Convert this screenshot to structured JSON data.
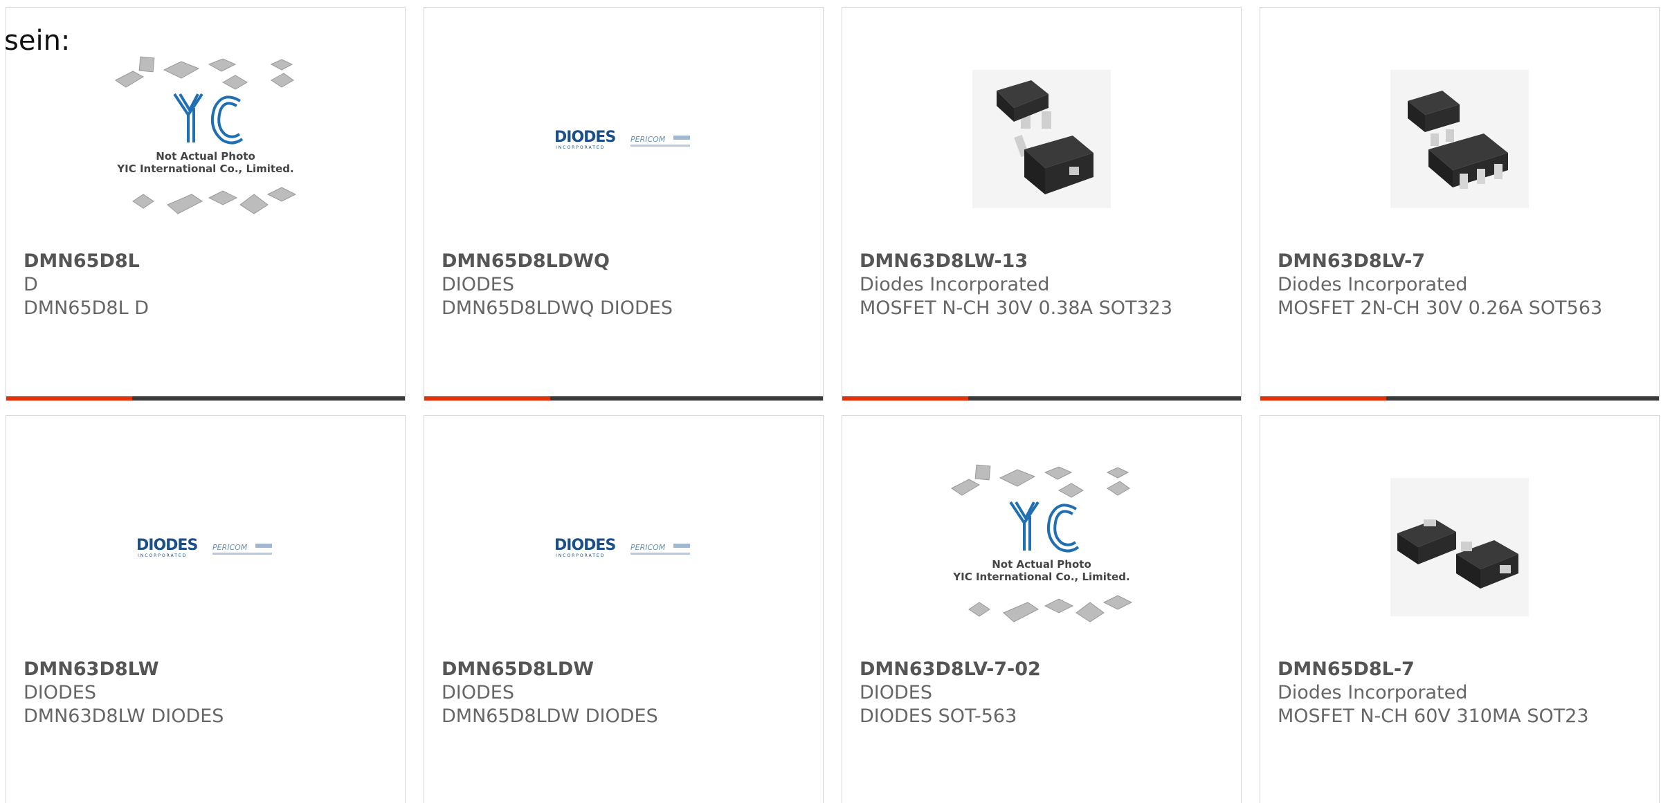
{
  "intro_text": "sein:",
  "placeholder": {
    "line1": "Not Actual Photo",
    "line2": "YIC International Co., Limited."
  },
  "logo": {
    "brand": "DIODES",
    "sub": "INCORPORATED",
    "partner": "PERICOM"
  },
  "colors": {
    "accent": "#e0330b",
    "bar": "#3a3a3a",
    "yic_blue": "#1f6fb2",
    "diodes_blue": "#1b4f8a"
  },
  "products": [
    {
      "part": "DMN65D8L",
      "maker": "D",
      "desc": "DMN65D8L D",
      "image": "yic-placeholder"
    },
    {
      "part": "DMN65D8LDWQ",
      "maker": "DIODES",
      "desc": "DMN65D8LDWQ DIODES",
      "image": "diodes-logo"
    },
    {
      "part": "DMN63D8LW-13",
      "maker": "Diodes Incorporated",
      "desc": "MOSFET N-CH 30V 0.38A SOT323",
      "image": "sot323-photo"
    },
    {
      "part": "DMN63D8LV-7",
      "maker": "Diodes Incorporated",
      "desc": "MOSFET 2N-CH 30V 0.26A SOT563",
      "image": "sot563-photo"
    },
    {
      "part": "DMN63D8LW",
      "maker": "DIODES",
      "desc": "DMN63D8LW DIODES",
      "image": "diodes-logo"
    },
    {
      "part": "DMN65D8LDW",
      "maker": "DIODES",
      "desc": "DMN65D8LDW DIODES",
      "image": "diodes-logo"
    },
    {
      "part": "DMN63D8LV-7-02",
      "maker": "DIODES",
      "desc": "DIODES SOT-563",
      "image": "yic-placeholder"
    },
    {
      "part": "DMN65D8L-7",
      "maker": "Diodes Incorporated",
      "desc": "MOSFET N-CH 60V 310MA SOT23",
      "image": "sot23-photo"
    }
  ]
}
